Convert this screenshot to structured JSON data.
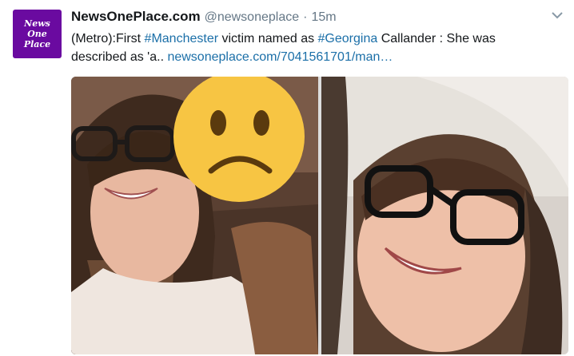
{
  "avatar": {
    "line1": "News",
    "line2": "One",
    "line3": "Place"
  },
  "tweet": {
    "display_name": "NewsOnePlace.com",
    "handle": "@newsoneplace",
    "separator": "·",
    "time": "15m",
    "text_part1": "(Metro):First ",
    "hashtag1": "#Manchester",
    "text_part2": " victim named as ",
    "hashtag2": "#Georgina",
    "text_part3": " Callander : She was",
    "text_part4": "described as 'a.. ",
    "link": "newsoneplace.com/7041561701/man…"
  },
  "icons": {
    "menu": "chevron-down-icon",
    "emoji": "sad-face-emoji"
  },
  "colors": {
    "brand_purple": "#6a0aa0",
    "link": "#1b6fa8",
    "meta_gray": "#657786",
    "emoji_yellow": "#f7c543"
  }
}
